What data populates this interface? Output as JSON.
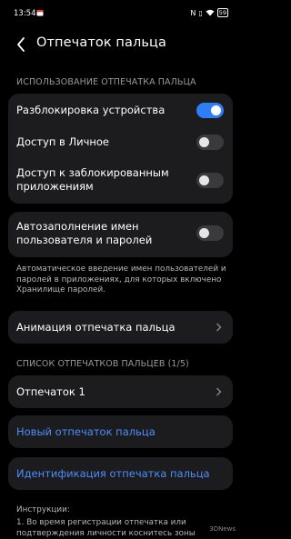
{
  "status_bar": {
    "time": "13:54",
    "battery": "59",
    "icons": [
      "calendar-icon",
      "nfc-icon",
      "vibrate-icon",
      "wifi-icon",
      "battery-icon"
    ]
  },
  "header": {
    "title": "Отпечаток пальца"
  },
  "section_usage": {
    "title": "ИСПОЛЬЗОВАНИЕ ОТПЕЧАТКА ПАЛЬЦА",
    "items": [
      {
        "label": "Разблокировка устройства",
        "enabled": true
      },
      {
        "label": "Доступ в Личное",
        "enabled": false
      },
      {
        "label": "Доступ к заблокированным приложениям",
        "enabled": false
      }
    ]
  },
  "autofill": {
    "label": "Автозаполнение имен пользователя и паролей",
    "enabled": false,
    "description": "Автоматическое введение имен пользователей и паролей в приложениях, для которых включено Хранилище паролей."
  },
  "animation": {
    "label": "Анимация отпечатка пальца"
  },
  "section_list": {
    "title": "СПИСОК ОТПЕЧАТКОВ ПАЛЬЦЕВ (1/5)",
    "fingerprints": [
      "Отпечаток 1"
    ]
  },
  "actions": {
    "new_fingerprint": "Новый отпечаток пальца",
    "identify": "Идентификация отпечатка пальца"
  },
  "instructions": {
    "title": "Инструкции:",
    "text": "1. Во время регистрации отпечатка или подтверждения личности коснитесь зоны"
  },
  "watermark": "3DNews",
  "colors": {
    "background": "#000000",
    "card": "#1c1c1e",
    "accent": "#2f7ef5",
    "link": "#4c8dff"
  }
}
